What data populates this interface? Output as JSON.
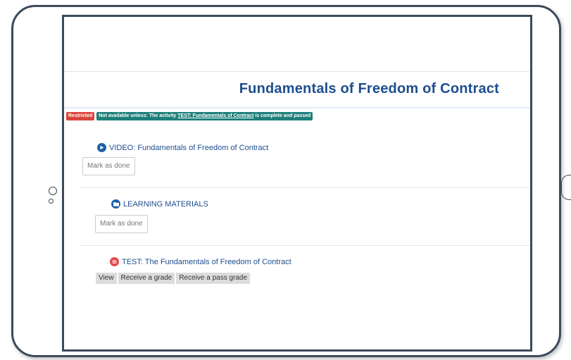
{
  "page": {
    "title": "Fundamentals of Freedom of Contract"
  },
  "restriction": {
    "badge": "Restricted",
    "text_before": "Not available unless: The activity ",
    "link": "TEST: Fundamentals of Contract",
    "text_after": " is complete and passed"
  },
  "activities": [
    {
      "icon": "video-icon",
      "label": "VIDEO: Fundamentals of Freedom of Contract",
      "button": "Mark as done"
    },
    {
      "icon": "folder-icon",
      "label": "LEARNING MATERIALS",
      "button": "Mark as done"
    },
    {
      "icon": "quiz-icon",
      "label": "TEST: The Fundamentals of Freedom of Contract",
      "conditions": [
        "View",
        "Receive a grade",
        "Receive a pass grade"
      ]
    }
  ],
  "colors": {
    "frame": "#3c4a5a",
    "title": "#1d4e8f",
    "restricted_badge": "#d9453b",
    "info_badge": "#1e7f7a",
    "icon_blue": "#1f5fa8",
    "icon_red": "#e5484d"
  }
}
